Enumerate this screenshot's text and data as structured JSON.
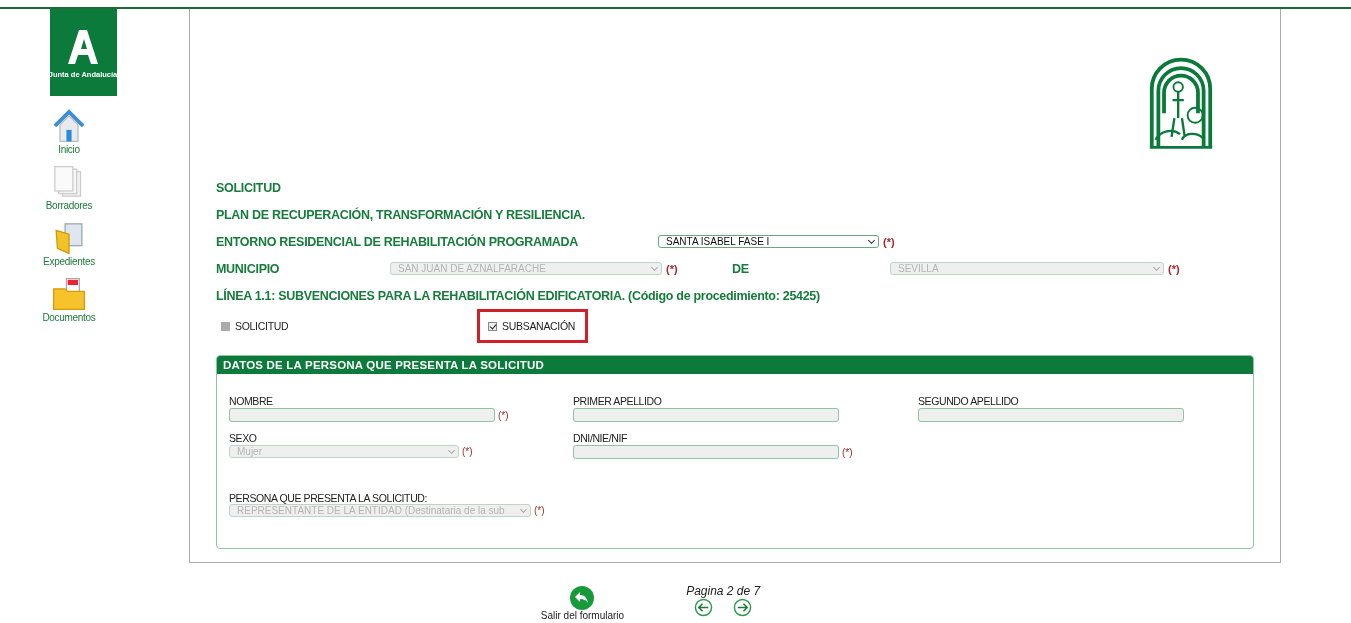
{
  "logo": {
    "text": "Junta de Andalucía"
  },
  "sidebar": {
    "items": [
      {
        "label": "Inicio"
      },
      {
        "label": "Borradores"
      },
      {
        "label": "Expedientes"
      },
      {
        "label": "Documentos"
      }
    ]
  },
  "form": {
    "headings": [
      "SOLICITUD",
      "PLAN DE RECUPERACIÓN, TRANSFORMACIÓN Y RESILIENCIA."
    ],
    "entorno": {
      "label": "ENTORNO RESIDENCIAL DE REHABILITACIÓN PROGRAMADA",
      "value": "SANTA ISABEL FASE I",
      "disabled": false,
      "required_mark": "(*)"
    },
    "municipio": {
      "label": "MUNICIPIO",
      "value": "SAN JUAN DE AZNALFARACHE",
      "disabled": true,
      "required_mark": "(*)"
    },
    "provincia": {
      "label": "DE",
      "value": "SEVILLA",
      "disabled": true,
      "required_mark": "(*)"
    },
    "line_title": "LÍNEA 1.1: SUBVENCIONES PARA LA REHABILITACIÓN EDIFICATORIA. (Código de procedimiento: 25425)",
    "options": [
      {
        "label": "SOLICITUD",
        "checked": false,
        "highlighted": false
      },
      {
        "label": "SUBSANACIÓN",
        "checked": true,
        "highlighted": true
      }
    ],
    "section": {
      "title": "DATOS DE LA PERSONA QUE PRESENTA LA SOLICITUD",
      "fields": [
        {
          "kind": "input",
          "label": "NOMBRE",
          "disabled": true,
          "required_mark": "(*)"
        },
        {
          "kind": "input",
          "label": "PRIMER APELLIDO",
          "disabled": true
        },
        {
          "kind": "input",
          "label": "SEGUNDO APELLIDO",
          "disabled": true
        },
        {
          "kind": "select",
          "label": "SEXO",
          "value": "Mujer",
          "disabled": true,
          "required_mark": "(*)"
        },
        {
          "kind": "input",
          "label": "DNI/NIE/NIF",
          "disabled": true,
          "required_mark": "(*)"
        },
        {
          "kind": "select",
          "label": "PERSONA QUE PRESENTA LA SOLICITUD:",
          "value": "REPRESENTANTE DE LA ENTIDAD (Destinataria de la sub",
          "disabled": true,
          "required_mark": "(*)"
        }
      ]
    }
  },
  "footer": {
    "exit_label": "Salir del formulario",
    "page_label": "Pagina 2 de 7"
  }
}
